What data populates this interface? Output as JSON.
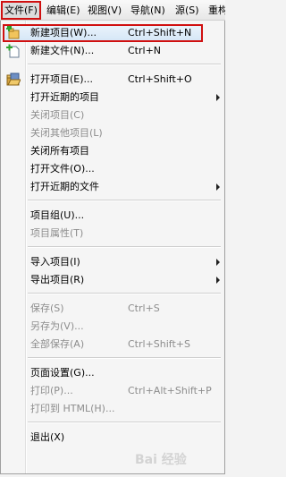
{
  "menubar": {
    "items": [
      {
        "label": "文件(F)"
      },
      {
        "label": "编辑(E)"
      },
      {
        "label": "视图(V)"
      },
      {
        "label": "导航(N)"
      },
      {
        "label": "源(S)"
      },
      {
        "label": "重构"
      }
    ]
  },
  "file_menu": {
    "items": [
      {
        "label": "新建项目(W)...",
        "accel": "Ctrl+Shift+N"
      },
      {
        "label": "新建文件(N)...",
        "accel": "Ctrl+N"
      },
      {
        "label": "打开项目(E)...",
        "accel": "Ctrl+Shift+O"
      },
      {
        "label": "打开近期的项目",
        "accel": ""
      },
      {
        "label": "关闭项目(C)",
        "accel": ""
      },
      {
        "label": "关闭其他项目(L)",
        "accel": ""
      },
      {
        "label": "关闭所有项目",
        "accel": ""
      },
      {
        "label": "打开文件(O)...",
        "accel": ""
      },
      {
        "label": "打开近期的文件",
        "accel": ""
      },
      {
        "label": "项目组(U)...",
        "accel": ""
      },
      {
        "label": "项目属性(T)",
        "accel": ""
      },
      {
        "label": "导入项目(I)",
        "accel": ""
      },
      {
        "label": "导出项目(R)",
        "accel": ""
      },
      {
        "label": "保存(S)",
        "accel": "Ctrl+S"
      },
      {
        "label": "另存为(V)...",
        "accel": ""
      },
      {
        "label": "全部保存(A)",
        "accel": "Ctrl+Shift+S"
      },
      {
        "label": "页面设置(G)...",
        "accel": ""
      },
      {
        "label": "打印(P)...",
        "accel": "Ctrl+Alt+Shift+P"
      },
      {
        "label": "打印到 HTML(H)...",
        "accel": ""
      },
      {
        "label": "退出(X)",
        "accel": ""
      }
    ]
  },
  "watermark": {
    "text": "Bai 经验"
  },
  "colors": {
    "highlight_border": "#d01010",
    "disabled_text": "#8d8d8d",
    "menu_bg": "#f5f5f5"
  }
}
